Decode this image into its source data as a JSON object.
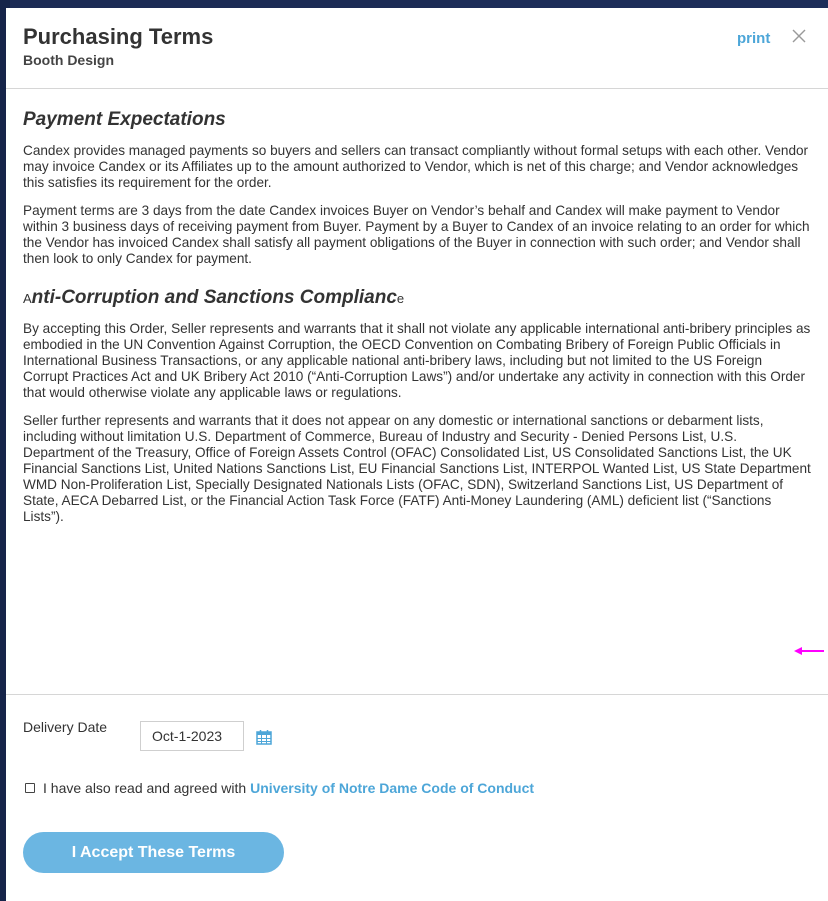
{
  "modal": {
    "title": "Purchasing Terms",
    "subtitle": "Booth Design",
    "print_label": "print"
  },
  "sections": [
    {
      "heading": "Payment Expectations",
      "paragraphs": [
        "Candex provides managed payments so buyers and sellers can transact compliantly without formal setups with each other. Vendor may invoice Candex or its Affiliates up to the amount authorized to Vendor, which is net of this charge; and Vendor acknowledges this satisfies its requirement for the order.",
        "Payment terms are 3 days from the date Candex invoices Buyer on Vendor’s behalf and Candex will make payment to Vendor within 3 business days of receiving payment from Buyer. Payment by a Buyer to Candex of an invoice relating to an order for which the Vendor has invoiced Candex shall satisfy all payment obligations of the Buyer in connection with such order; and Vendor shall then look to only Candex for payment."
      ]
    },
    {
      "heading_prefix": "A",
      "heading": "nti-Corruption and Sanctions Complianc",
      "heading_suffix": "e",
      "paragraphs": [
        "By accepting this Order, Seller represents and warrants that it shall not violate any applicable international anti-bribery principles as embodied in the UN Convention Against Corruption, the OECD Convention on Combating Bribery of Foreign Public Officials in International Business Transactions, or any applicable national anti-bribery laws, including but not limited to the US Foreign Corrupt Practices Act and UK Bribery Act 2010 (“Anti-Corruption Laws”) and/or undertake any activity in connection with this Order that would otherwise violate any applicable laws or regulations.",
        "Seller further represents and warrants that it does not appear on any domestic or international sanctions or debarment lists, including without limitation U.S. Department of Commerce, Bureau of Industry and Security - Denied Persons List, U.S. Department of the Treasury, Office of Foreign Assets Control (OFAC) Consolidated List, US Consolidated Sanctions List, the UK Financial Sanctions List, United Nations Sanctions List, EU Financial Sanctions List, INTERPOL Wanted List, US State Department WMD Non-Proliferation List, Specially Designated Nationals Lists (OFAC, SDN), Switzerland Sanctions List, US Department of State, AECA Debarred List, or the Financial Action Task Force (FATF) Anti-Money Laundering (AML) deficient list (“Sanctions Lists”)."
      ]
    }
  ],
  "delivery": {
    "label": "Delivery Date",
    "value": "Oct-1-2023"
  },
  "agreement": {
    "text": "I have also read and agreed with",
    "link": "University of Notre Dame Code of Conduct",
    "checked": false
  },
  "accept_button": "I Accept These Terms",
  "colors": {
    "accent": "#4da6d8",
    "button": "#6bb6e2",
    "backdrop": "#1c2b55",
    "arrow": "#ff00ff"
  }
}
